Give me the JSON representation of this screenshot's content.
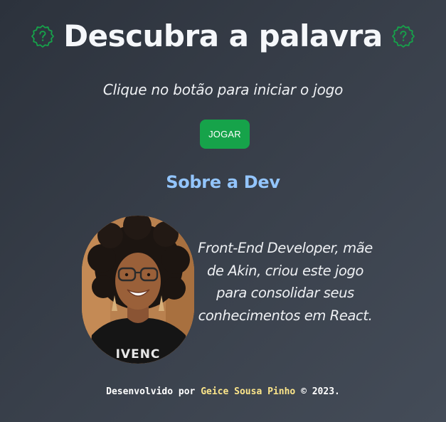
{
  "header": {
    "title": "Descubra a palavra",
    "left_icon": "question-badge-icon",
    "right_icon": "question-badge-icon",
    "icon_color": "#16a34a"
  },
  "intro": {
    "instruction": "Clique no botão para iniciar o jogo"
  },
  "actions": {
    "play_label": "JOGAR",
    "play_color": "#16a34a"
  },
  "about": {
    "heading": "Sobre a Dev",
    "heading_color": "#93c5fd",
    "photo_icon": "developer-portrait",
    "bio": "Front-End Developer, mãe de Akin, criou este jogo para consolidar seus conhecimentos em React."
  },
  "footer": {
    "prefix": "Desenvolvido por",
    "author": "Geice Sousa Pinho",
    "suffix": "© 2023.",
    "author_color": "#fde68a"
  }
}
